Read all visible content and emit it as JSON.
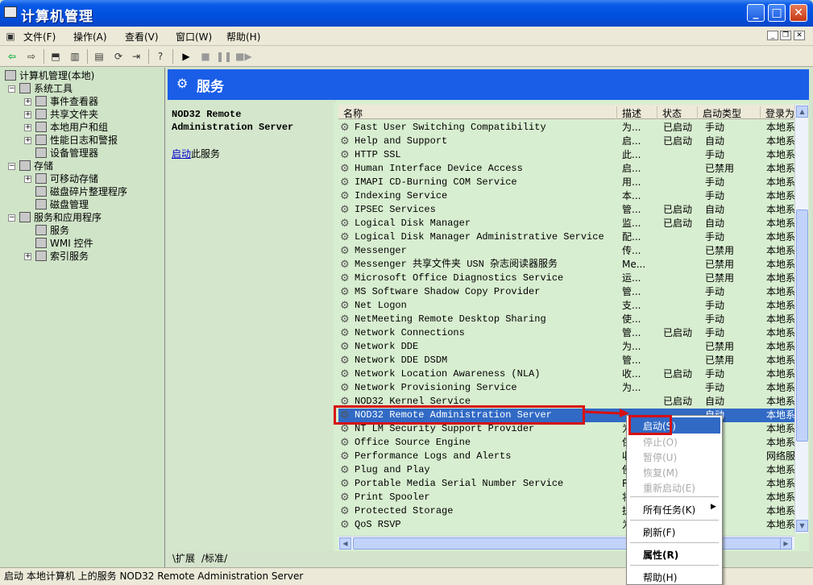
{
  "window": {
    "title": "计算机管理"
  },
  "menu": [
    "文件(F)",
    "操作(A)",
    "查看(V)",
    "窗口(W)",
    "帮助(H)"
  ],
  "tree": [
    {
      "label": "计算机管理(本地)",
      "level": 0
    },
    {
      "label": "系统工具",
      "level": 1
    },
    {
      "label": "事件查看器",
      "level": 2
    },
    {
      "label": "共享文件夹",
      "level": 2
    },
    {
      "label": "本地用户和组",
      "level": 2
    },
    {
      "label": "性能日志和警报",
      "level": 2
    },
    {
      "label": "设备管理器",
      "level": 2
    },
    {
      "label": "存储",
      "level": 1
    },
    {
      "label": "可移动存储",
      "level": 2
    },
    {
      "label": "磁盘碎片整理程序",
      "level": 2
    },
    {
      "label": "磁盘管理",
      "level": 2
    },
    {
      "label": "服务和应用程序",
      "level": 1
    },
    {
      "label": "服务",
      "level": 2
    },
    {
      "label": "WMI 控件",
      "level": 2
    },
    {
      "label": "索引服务",
      "level": 2
    }
  ],
  "header": {
    "title": "服务"
  },
  "left_pane": {
    "service_line1": "NOD32 Remote",
    "service_line2": "Administration Server",
    "action_link": "启动",
    "action_rest": "此服务"
  },
  "columns": [
    "名称",
    "描述",
    "状态",
    "启动类型",
    "登录为"
  ],
  "rows": [
    [
      "Fast User Switching Compatibility",
      "为...",
      "已启动",
      "手动",
      "本地系"
    ],
    [
      "Help and Support",
      "启...",
      "已启动",
      "自动",
      "本地系"
    ],
    [
      "HTTP SSL",
      "此...",
      "",
      "手动",
      "本地系"
    ],
    [
      "Human Interface Device Access",
      "启...",
      "",
      "已禁用",
      "本地系"
    ],
    [
      "IMAPI CD-Burning COM Service",
      "用...",
      "",
      "手动",
      "本地系"
    ],
    [
      "Indexing Service",
      "本...",
      "",
      "手动",
      "本地系"
    ],
    [
      "IPSEC Services",
      "管...",
      "已启动",
      "自动",
      "本地系"
    ],
    [
      "Logical Disk Manager",
      "监...",
      "已启动",
      "自动",
      "本地系"
    ],
    [
      "Logical Disk Manager Administrative Service",
      "配...",
      "",
      "手动",
      "本地系"
    ],
    [
      "Messenger",
      "传...",
      "",
      "已禁用",
      "本地系"
    ],
    [
      "Messenger 共享文件夹 USN 杂志阅读器服务",
      "Me...",
      "",
      "已禁用",
      "本地系"
    ],
    [
      "Microsoft Office Diagnostics Service",
      "运...",
      "",
      "已禁用",
      "本地系"
    ],
    [
      "MS Software Shadow Copy Provider",
      "管...",
      "",
      "手动",
      "本地系"
    ],
    [
      "Net Logon",
      "支...",
      "",
      "手动",
      "本地系"
    ],
    [
      "NetMeeting Remote Desktop Sharing",
      "使...",
      "",
      "手动",
      "本地系"
    ],
    [
      "Network Connections",
      "管...",
      "已启动",
      "手动",
      "本地系"
    ],
    [
      "Network DDE",
      "为...",
      "",
      "已禁用",
      "本地系"
    ],
    [
      "Network DDE DSDM",
      "管...",
      "",
      "已禁用",
      "本地系"
    ],
    [
      "Network Location Awareness (NLA)",
      "收...",
      "已启动",
      "手动",
      "本地系"
    ],
    [
      "Network Provisioning Service",
      "为...",
      "",
      "手动",
      "本地系"
    ],
    [
      "NOD32 Kernel Service",
      "",
      "已启动",
      "自动",
      "本地系"
    ],
    [
      "NOD32 Remote Administration Server",
      "",
      "",
      "自动",
      "本地系"
    ],
    [
      "NT LM Security Support Provider",
      "为",
      "",
      "",
      "本地系"
    ],
    [
      "Office Source Engine",
      "保",
      "",
      "用",
      "本地系"
    ],
    [
      "Performance Logs and Alerts",
      "收",
      "",
      "",
      "网络服"
    ],
    [
      "Plug and Play",
      "使",
      "",
      "",
      "本地系"
    ],
    [
      "Portable Media Serial Number Service",
      "R",
      "",
      "",
      "本地系"
    ],
    [
      "Print Spooler",
      "将",
      "",
      "",
      "本地系"
    ],
    [
      "Protected Storage",
      "提",
      "",
      "",
      "本地系"
    ],
    [
      "QoS RSVP",
      "为",
      "",
      "",
      "本地系"
    ]
  ],
  "context_menu": [
    {
      "label": "启动(S)",
      "disabled": false
    },
    {
      "label": "停止(O)",
      "disabled": true
    },
    {
      "label": "暂停(U)",
      "disabled": true
    },
    {
      "label": "恢复(M)",
      "disabled": true
    },
    {
      "label": "重新启动(E)",
      "disabled": true
    },
    {
      "label": "所有任务(K)",
      "disabled": false
    },
    {
      "label": "刷新(F)",
      "disabled": false
    },
    {
      "label": "属性(R)",
      "disabled": false
    },
    {
      "label": "帮助(H)",
      "disabled": false
    }
  ],
  "tabs": [
    "扩展",
    "标准"
  ],
  "status": "启动 本地计算机 上的服务 NOD32 Remote Administration Server"
}
